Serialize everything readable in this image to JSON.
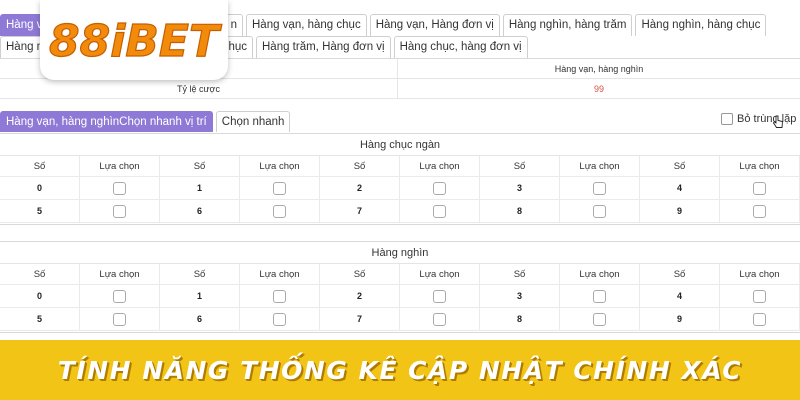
{
  "tabs_row1": [
    "Hàng vạ",
    "n",
    "Hàng vạn, hàng chục",
    "Hàng vạn, Hàng đơn vị",
    "Hàng nghìn, hàng trăm",
    "Hàng nghìn, hàng chục"
  ],
  "tabs_row2": [
    "Hàng n",
    "hục",
    "Hàng trăm, Hàng đơn vị",
    "Hàng chục, hàng đơn vị"
  ],
  "odds": {
    "label": "Tỷ lệ cược",
    "column_header": "Hàng vạn, hàng nghìn",
    "value": "99"
  },
  "subtabs": [
    "Hàng vạn, hàng nghìnChọn nhanh vị trí",
    "Chọn nhanh"
  ],
  "dedupe_label": "Bỏ trùng lặp",
  "sections": [
    {
      "title": "Hàng chục ngàn",
      "col_number": "Số",
      "col_choice": "Lựa chọn",
      "rows": [
        [
          "0",
          "1",
          "2",
          "3",
          "4"
        ],
        [
          "5",
          "6",
          "7",
          "8",
          "9"
        ]
      ]
    },
    {
      "title": "Hàng nghìn",
      "col_number": "Số",
      "col_choice": "Lựa chọn",
      "rows": [
        [
          "0",
          "1",
          "2",
          "3",
          "4"
        ],
        [
          "5",
          "6",
          "7",
          "8",
          "9"
        ]
      ]
    }
  ],
  "logo_text": "88iBET",
  "banner_text": "TÍNH NĂNG THỐNG KÊ CẬP NHẬT CHÍNH XÁC",
  "colors": {
    "accent_purple": "#8e7ad6",
    "banner_yellow": "#f2c416",
    "logo_orange": "#f28a0c",
    "odds_red": "#d9534f"
  }
}
